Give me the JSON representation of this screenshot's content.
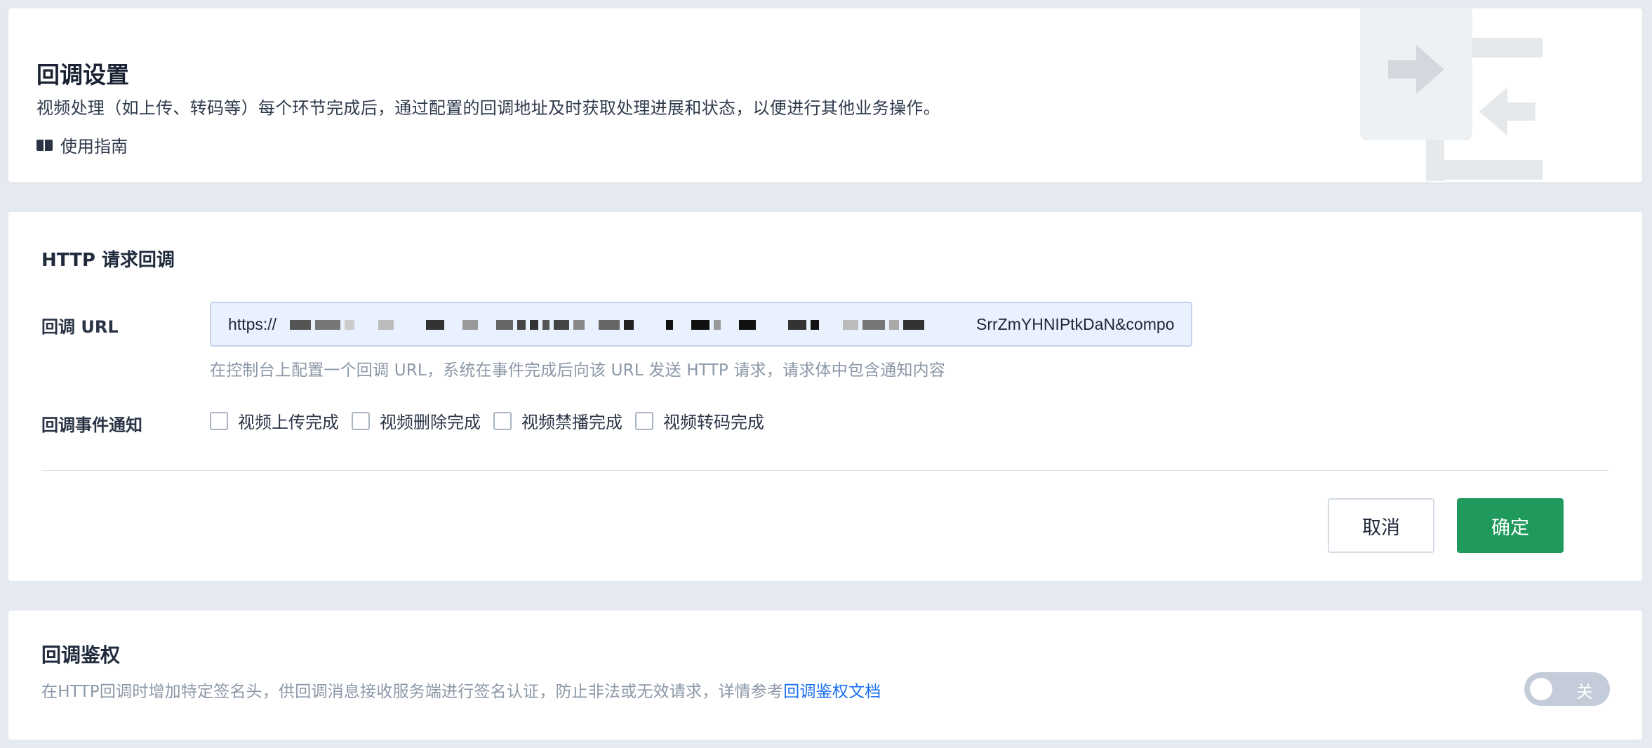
{
  "intro": {
    "title": "回调设置",
    "description": "视频处理（如上传、转码等）每个环节完成后，通过配置的回调地址及时获取处理进展和状态，以便进行其他业务操作。",
    "guide_label": "使用指南"
  },
  "http": {
    "section_title": "HTTP 请求回调",
    "url_label": "回调 URL",
    "url_prefix": "https://",
    "url_suffix": "SrrZmYHNIPtkDaN&compo",
    "hint": "在控制台上配置一个回调 URL，系统在事件完成后向该 URL 发送 HTTP 请求，请求体中包含通知内容",
    "event_label": "回调事件通知",
    "events": [
      "视频上传完成",
      "视频删除完成",
      "视频禁播完成",
      "视频转码完成"
    ],
    "cancel_label": "取消",
    "ok_label": "确定"
  },
  "auth": {
    "title": "回调鉴权",
    "description": "在HTTP回调时增加特定签名头，供回调消息接收服务端进行签名认证，防止非法或无效请求，详情参考",
    "doc_link": "回调鉴权文档",
    "toggle_state": "关"
  },
  "colors": {
    "primary_button": "#1f9a5c",
    "link": "#1a6ff0",
    "page_background": "#e4eaf0"
  }
}
